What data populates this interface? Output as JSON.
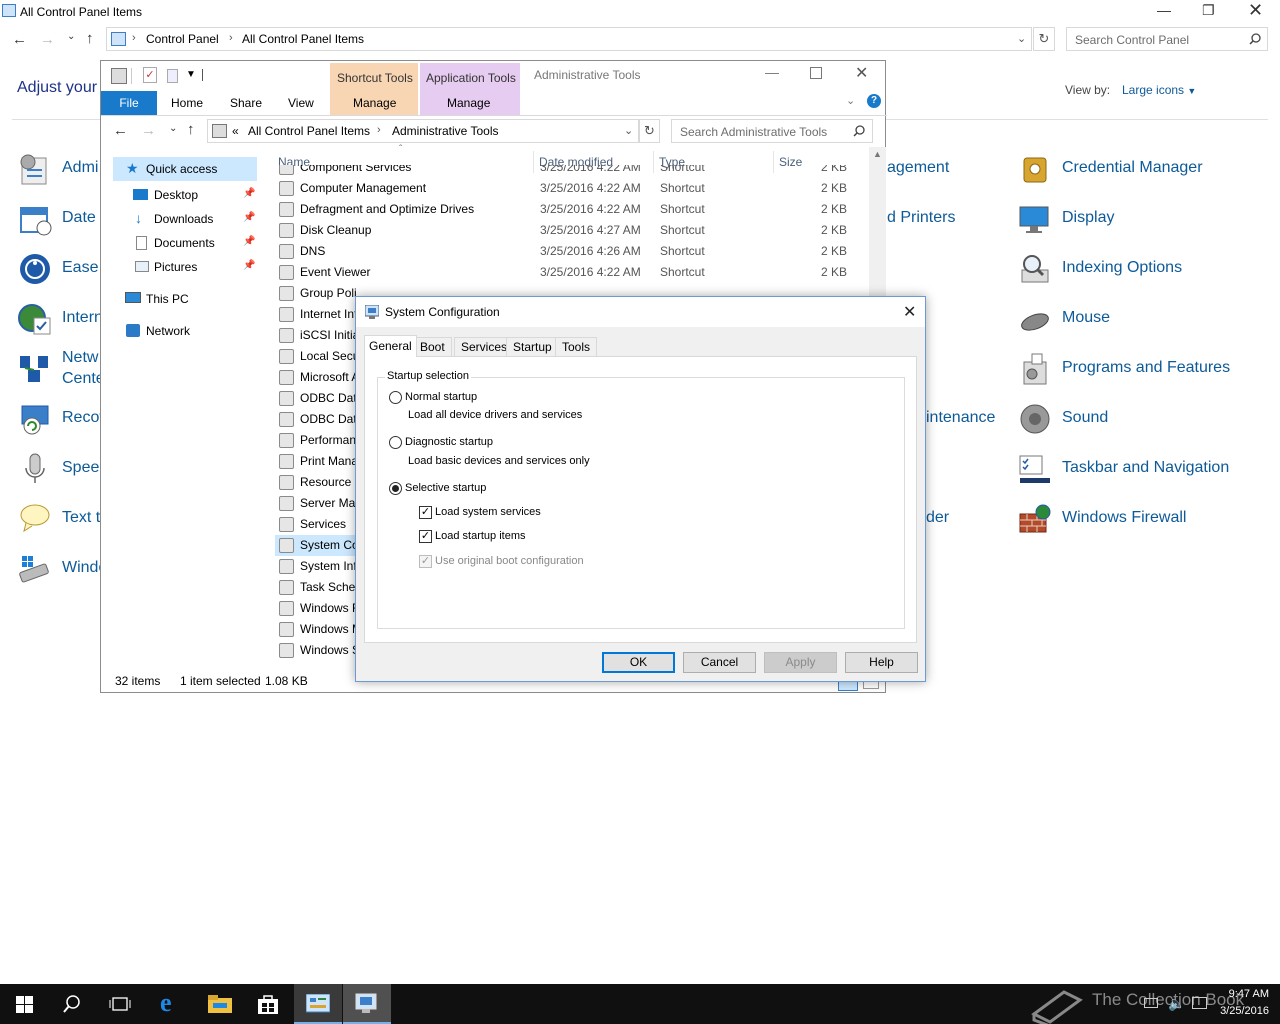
{
  "control_panel": {
    "title": "All Control Panel Items",
    "breadcrumb": [
      "Control Panel",
      "All Control Panel Items"
    ],
    "search_placeholder": "Search Control Panel",
    "heading_partial": "Adjust your",
    "view_by_label": "View by:",
    "view_by_value": "Large icons",
    "left_items": [
      "Admi",
      "Date a",
      "Ease c",
      "Intern",
      "Netw",
      "Cente",
      "Recov",
      "Speec",
      "Text to",
      "Windo"
    ],
    "middle_items": [
      "agement",
      "d Printers",
      "intenance",
      "der"
    ],
    "right_items": [
      "Credential Manager",
      "Display",
      "Indexing Options",
      "Mouse",
      "Programs and Features",
      "Sound",
      "Taskbar and Navigation",
      "Windows Firewall"
    ]
  },
  "explorer": {
    "ribbon_context_1": "Shortcut Tools",
    "ribbon_context_2": "Application Tools",
    "window_title": "Administrative Tools",
    "tabs": [
      "File",
      "Home",
      "Share",
      "View",
      "Manage",
      "Manage"
    ],
    "breadcrumb_prefix": "«",
    "breadcrumb": [
      "All Control Panel Items",
      "Administrative Tools"
    ],
    "search_placeholder": "Search Administrative Tools",
    "nav": [
      "Quick access",
      "Desktop",
      "Downloads",
      "Documents",
      "Pictures",
      "This PC",
      "Network"
    ],
    "columns": [
      "Name",
      "Date modified",
      "Type",
      "Size"
    ],
    "files": [
      {
        "name": "Component Services",
        "date": "3/25/2016 4:22 AM",
        "type": "Shortcut",
        "size": "2 KB"
      },
      {
        "name": "Computer Management",
        "date": "3/25/2016 4:22 AM",
        "type": "Shortcut",
        "size": "2 KB"
      },
      {
        "name": "Defragment and Optimize Drives",
        "date": "3/25/2016 4:22 AM",
        "type": "Shortcut",
        "size": "2 KB"
      },
      {
        "name": "Disk Cleanup",
        "date": "3/25/2016 4:27 AM",
        "type": "Shortcut",
        "size": "2 KB"
      },
      {
        "name": "DNS",
        "date": "3/25/2016 4:26 AM",
        "type": "Shortcut",
        "size": "2 KB"
      },
      {
        "name": "Event Viewer",
        "date": "3/25/2016 4:22 AM",
        "type": "Shortcut",
        "size": "2 KB"
      },
      {
        "name": "Group Poli"
      },
      {
        "name": "Internet Inf"
      },
      {
        "name": "iSCSI Initiat"
      },
      {
        "name": "Local Secu"
      },
      {
        "name": "Microsoft A"
      },
      {
        "name": "ODBC Data"
      },
      {
        "name": "ODBC Data"
      },
      {
        "name": "Performan"
      },
      {
        "name": "Print Mana"
      },
      {
        "name": "Resource M"
      },
      {
        "name": "Server Mar"
      },
      {
        "name": "Services"
      },
      {
        "name": "System Co"
      },
      {
        "name": "System Inf"
      },
      {
        "name": "Task Sched"
      },
      {
        "name": "Windows F"
      },
      {
        "name": "Windows M"
      },
      {
        "name": "Windows S"
      }
    ],
    "status_count": "32 items",
    "status_selected": "1 item selected",
    "status_size": "1.08 KB"
  },
  "dialog": {
    "title": "System Configuration",
    "tabs": [
      "General",
      "Boot",
      "Services",
      "Startup",
      "Tools"
    ],
    "group_label": "Startup selection",
    "normal_label": "Normal startup",
    "normal_desc": "Load all device drivers and services",
    "diagnostic_label": "Diagnostic startup",
    "diagnostic_desc": "Load basic devices and services only",
    "selective_label": "Selective startup",
    "load_services": "Load system services",
    "load_startup": "Load startup items",
    "use_original": "Use original boot configuration",
    "ok": "OK",
    "cancel": "Cancel",
    "apply": "Apply",
    "help": "Help"
  },
  "taskbar": {
    "time": "9:47 AM",
    "date": "3/25/2016",
    "watermark": "The Collection Book"
  }
}
